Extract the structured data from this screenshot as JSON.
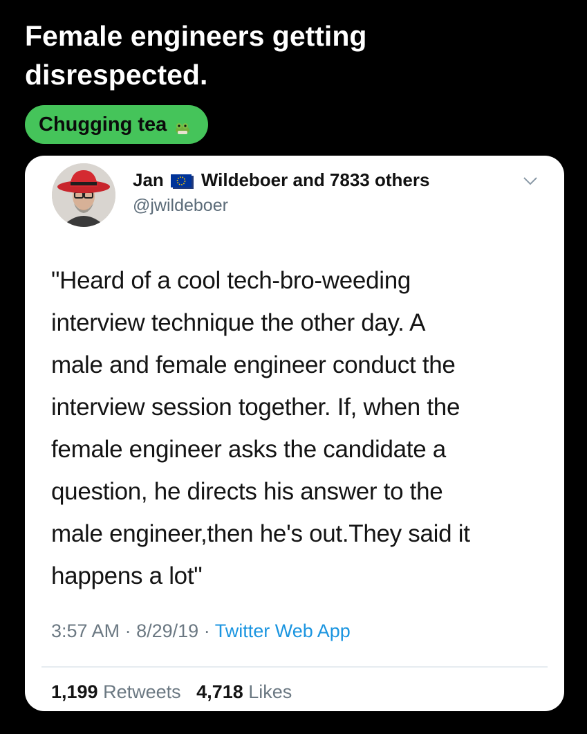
{
  "post": {
    "title_lines": [
      "Female engineers getting",
      "disrespected."
    ],
    "flair": {
      "label": "Chugging tea",
      "icon": "frog-tea-emoji-icon"
    }
  },
  "tweet": {
    "name_first": "Jan",
    "name_flag_icon": "eu-flag-icon",
    "name_rest": "Wildeboer and 7833 others",
    "handle": "@jwildeboer",
    "text_lines": [
      "\"Heard of a cool tech-bro-weeding",
      "interview technique the other day. A",
      "male and female engineer conduct the",
      "interview session together. If, when the",
      "female engineer asks the candidate a",
      "question, he directs his answer to the",
      "male engineer,then he's out.They said it",
      "happens a lot\""
    ],
    "time": "3:57 AM",
    "date": "8/29/19",
    "source": "Twitter Web App",
    "retweets": {
      "count": "1,199",
      "label": "Retweets"
    },
    "likes": {
      "count": "4,718",
      "label": "Likes"
    }
  },
  "colors": {
    "background": "#000000",
    "flair": "#45c45a",
    "card": "#ffffff",
    "link_blue": "#1b95e0",
    "muted_text": "#6b7882"
  }
}
